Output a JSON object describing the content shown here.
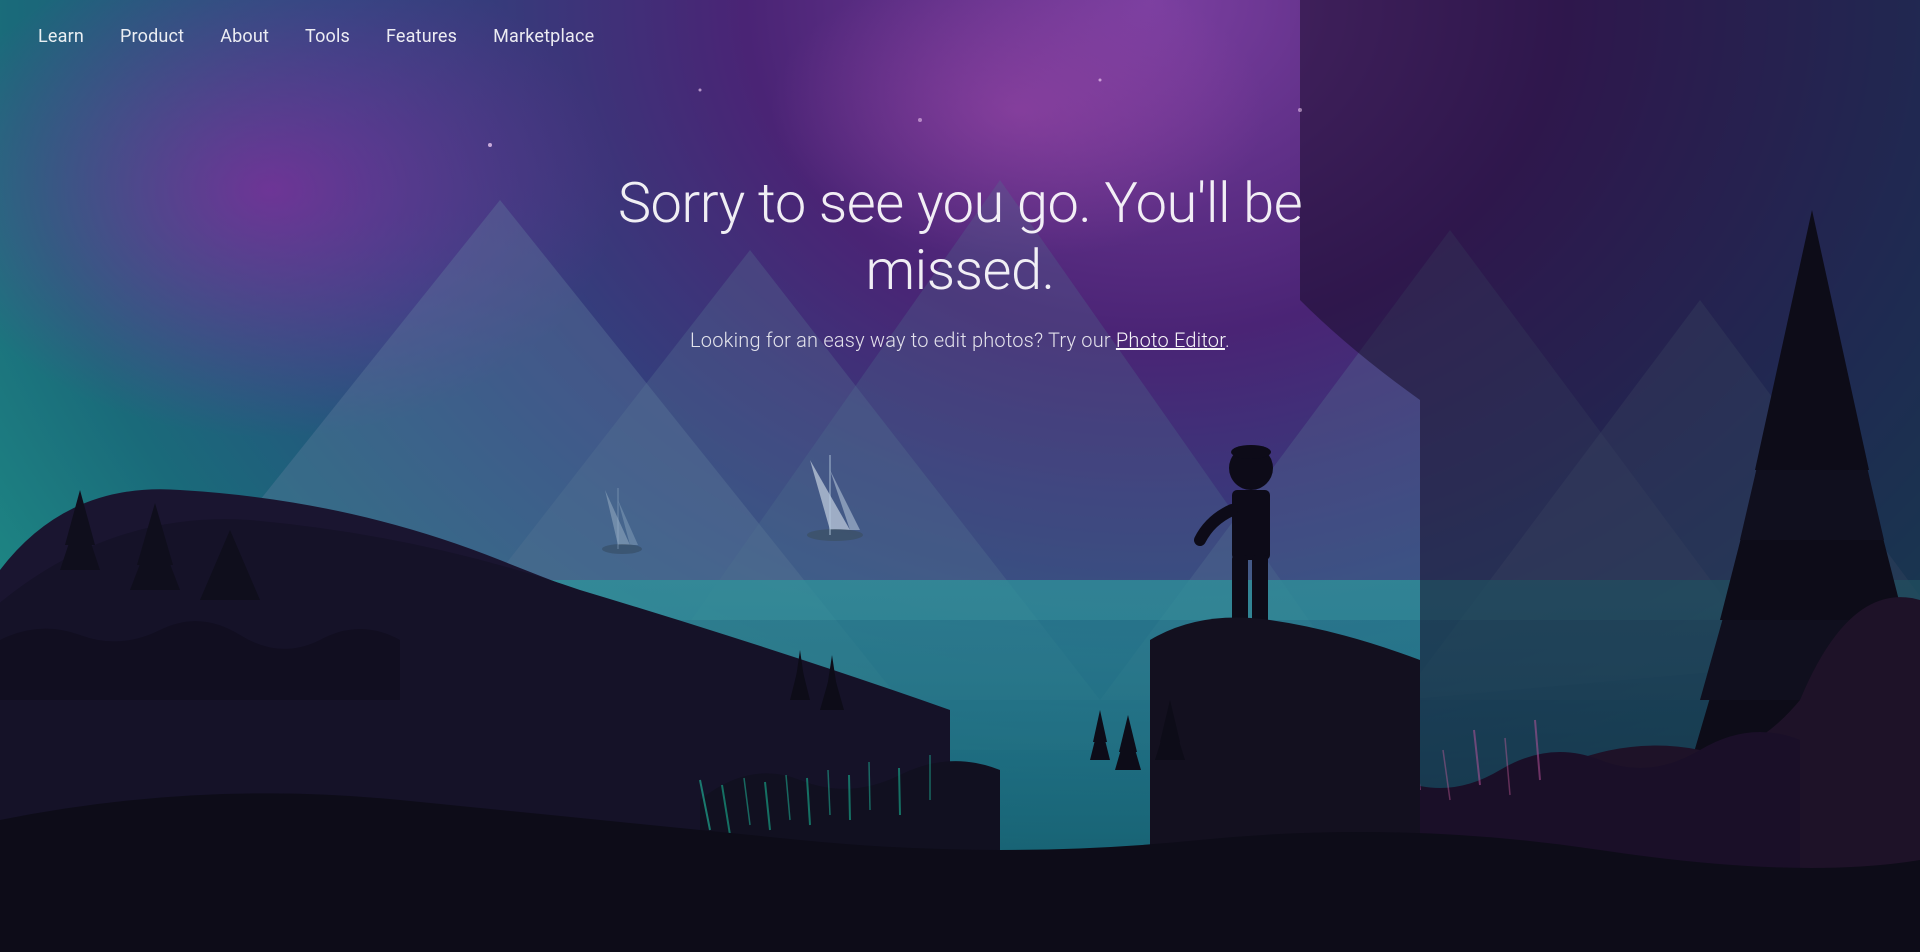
{
  "nav": {
    "items": [
      {
        "id": "learn",
        "label": "Learn"
      },
      {
        "id": "product",
        "label": "Product"
      },
      {
        "id": "about",
        "label": "About"
      },
      {
        "id": "tools",
        "label": "Tools"
      },
      {
        "id": "features",
        "label": "Features"
      },
      {
        "id": "marketplace",
        "label": "Marketplace"
      }
    ]
  },
  "hero": {
    "heading": "Sorry to see you go. You'll be missed.",
    "subtext_before": "Looking for an easy way to edit photos? Try our ",
    "link_label": "Photo Editor",
    "subtext_after": "."
  }
}
